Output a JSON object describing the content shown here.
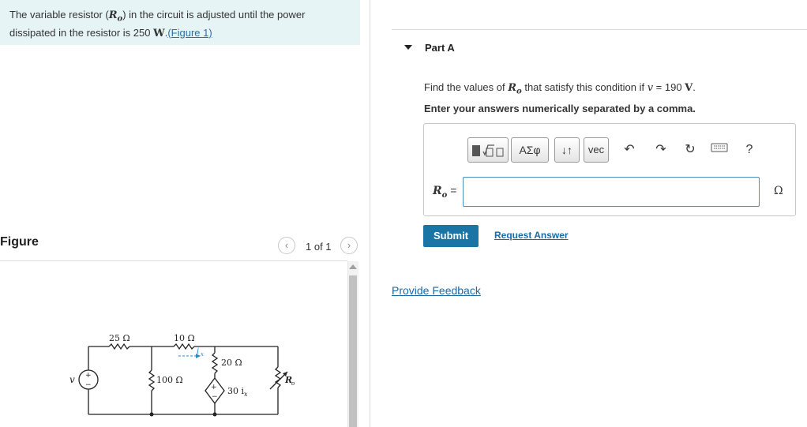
{
  "problem": {
    "text_before": "The variable resistor (",
    "variable": "R",
    "variable_sub": "o",
    "text_middle": ") in the circuit is adjusted until the power dissipated in the resistor is 250 ",
    "unit": "W",
    "period": ".",
    "figure_link": "(Figure 1)"
  },
  "figure_panel": {
    "heading": "Figure",
    "pager": "1 of 1",
    "prev_icon": "chevron-left-icon",
    "next_icon": "chevron-right-icon"
  },
  "circuit": {
    "r1": "25 Ω",
    "r2": "10 Ω",
    "r3": "100 Ω",
    "r4": "20 Ω",
    "source_v": "v",
    "source_plus": "+",
    "source_minus": "−",
    "current": "i",
    "current_sub": "x",
    "dep_source_label": "30 i",
    "dep_source_sub": "x",
    "dep_plus": "+",
    "dep_minus": "−",
    "ro": "R",
    "ro_sub": "o"
  },
  "part": {
    "title": "Part A",
    "question_before": "Find the values of ",
    "variable": "R",
    "variable_sub": "o",
    "question_middle": " that satisfy this condition if ",
    "v_symbol": "v",
    "question_value": " = 190 ",
    "v_unit": "V",
    "question_end": ".",
    "instruction": "Enter your answers numerically separated by a comma."
  },
  "toolbar": {
    "templates_icon": "templates-icon",
    "greek_label": "ΑΣφ",
    "arrows_label": "↓↑",
    "vec_label": "vec",
    "undo_icon": "undo-icon",
    "redo_icon": "redo-icon",
    "reset_icon": "reset-icon",
    "keyboard_icon": "keyboard-icon",
    "help_label": "?"
  },
  "answer": {
    "label_var": "R",
    "label_sub": "o",
    "label_eq": " =",
    "value": "",
    "unit": "Ω"
  },
  "actions": {
    "submit": "Submit",
    "request_answer": "Request Answer",
    "provide_feedback": "Provide Feedback"
  },
  "colors": {
    "problem_bg": "#e6f4f6",
    "submit_bg": "#1a74a6",
    "link": "#1a6aa6"
  }
}
